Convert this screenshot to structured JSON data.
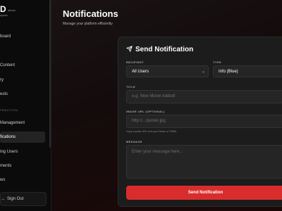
{
  "sidebar": {
    "brand": "D",
    "brand_tag": "admin",
    "brand_user": "oyush",
    "items": [
      {
        "label": "board"
      },
      {
        "label": "Content"
      },
      {
        "label": "ry"
      },
      {
        "label": "ests"
      },
      {
        "label": "Management"
      },
      {
        "label": "fications"
      },
      {
        "label": "ing Users"
      },
      {
        "label": "ments"
      },
      {
        "label": "ws"
      }
    ],
    "section_label": "TRACTION",
    "signout_label": "Sign Out"
  },
  "header": {
    "title": "Notifications",
    "subtitle": "Manage your platform efficiently"
  },
  "form": {
    "heading": "Send Notification",
    "recipient_label": "RECIPIENT",
    "recipient_value": "All Users",
    "type_label": "TYPE",
    "type_value": "Info (Blue)",
    "title_label": "TITLE",
    "title_placeholder": "e.g. New Movie Added!",
    "image_label": "IMAGE URL (OPTIONAL)",
    "image_placeholder": "http://.../poster.jpg",
    "image_helper": "Copy a poster URL from your library or TMDB.",
    "message_label": "MESSAGE",
    "message_placeholder": "Enter your message here...",
    "submit_label": "Send Notification"
  },
  "colors": {
    "accent": "#d92d2d",
    "card_bg": "#1c1c1c",
    "sidebar_bg": "#0b0b0b"
  }
}
